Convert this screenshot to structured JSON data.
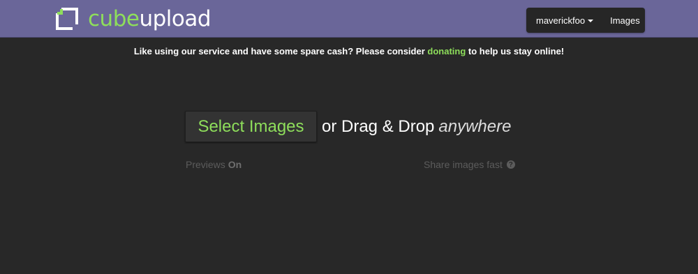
{
  "header": {
    "logo": {
      "text_cube": "cube",
      "text_upload": "upload",
      "icon": "cube-logo-icon"
    },
    "nav": {
      "user_label": "maverickfoo",
      "images_label": "Images"
    }
  },
  "donate": {
    "prefix": "Like using our service and have some spare cash? Please consider ",
    "link": "donating",
    "suffix": " to help us stay online!"
  },
  "upload": {
    "select_button": "Select Images",
    "drag_text": "or Drag & Drop",
    "drag_anywhere": "anywhere"
  },
  "options": {
    "previews_label": "Previews",
    "previews_state": "On",
    "share_text": "Share images fast",
    "help_icon": "?"
  },
  "colors": {
    "header_bg": "#6a6699",
    "accent_green": "#8ede5b",
    "page_bg": "#282828",
    "nav_bg": "#262626"
  }
}
